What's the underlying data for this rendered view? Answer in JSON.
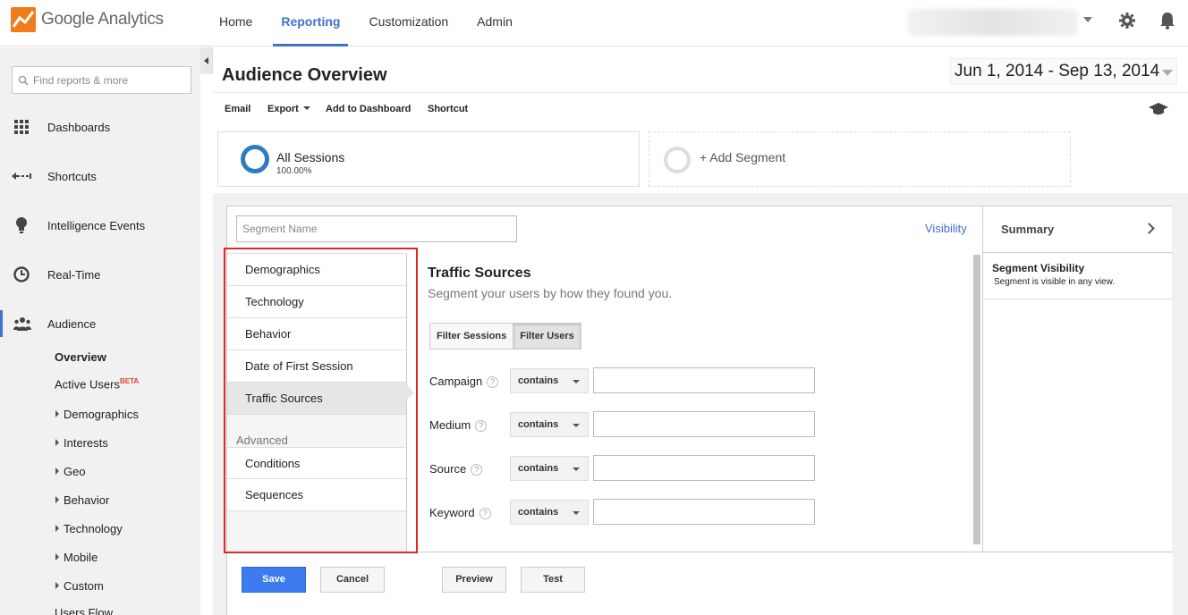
{
  "app": {
    "brand": "Google Analytics",
    "accent": "#3f72c8",
    "highlight": "#d72b2b"
  },
  "topnav": {
    "items": [
      "Home",
      "Reporting",
      "Customization",
      "Admin"
    ],
    "active": "Reporting"
  },
  "sidebar": {
    "search_placeholder": "Find reports & more",
    "sections": [
      {
        "label": "Dashboards",
        "icon": "grid-icon"
      },
      {
        "label": "Shortcuts",
        "icon": "shortcut-arrows-icon"
      },
      {
        "label": "Intelligence Events",
        "icon": "lightbulb-icon"
      },
      {
        "label": "Real-Time",
        "icon": "clock-icon"
      },
      {
        "label": "Audience",
        "icon": "people-icon"
      }
    ],
    "audience_items": {
      "overview": "Overview",
      "active_users": "Active Users",
      "active_users_badge": "BETA",
      "demographics": "Demographics",
      "interests": "Interests",
      "geo": "Geo",
      "behavior": "Behavior",
      "technology": "Technology",
      "mobile": "Mobile",
      "custom": "Custom",
      "users_flow": "Users Flow"
    }
  },
  "page": {
    "title": "Audience Overview",
    "date_range": "Jun 1, 2014 - Sep 13, 2014"
  },
  "actions": {
    "email": "Email",
    "export": "Export",
    "add_to_dashboard": "Add to Dashboard",
    "shortcut": "Shortcut"
  },
  "segments": {
    "current_name": "All Sessions",
    "current_pct": "100.00%",
    "add_label": "+ Add Segment"
  },
  "editor": {
    "segment_name_placeholder": "Segment Name",
    "visibility_link": "Visibility",
    "summary_title": "Summary",
    "summary_visibility_title": "Segment Visibility",
    "summary_visibility_desc": "Segment is visible in any view.",
    "categories": [
      "Demographics",
      "Technology",
      "Behavior",
      "Date of First Session",
      "Traffic Sources"
    ],
    "selected_category": "Traffic Sources",
    "advanced_label": "Advanced",
    "advanced_items": [
      "Conditions",
      "Sequences"
    ],
    "content_title": "Traffic Sources",
    "content_subtitle": "Segment your users by how they found you.",
    "toggle": {
      "sessions": "Filter Sessions",
      "users": "Filter Users",
      "active": "Filter Users"
    },
    "filters": [
      {
        "label": "Campaign",
        "operator": "contains",
        "value": ""
      },
      {
        "label": "Medium",
        "operator": "contains",
        "value": ""
      },
      {
        "label": "Source",
        "operator": "contains",
        "value": ""
      },
      {
        "label": "Keyword",
        "operator": "contains",
        "value": ""
      }
    ],
    "help_glyph": "?",
    "buttons": {
      "save": "Save",
      "cancel": "Cancel",
      "preview": "Preview",
      "test": "Test"
    }
  }
}
